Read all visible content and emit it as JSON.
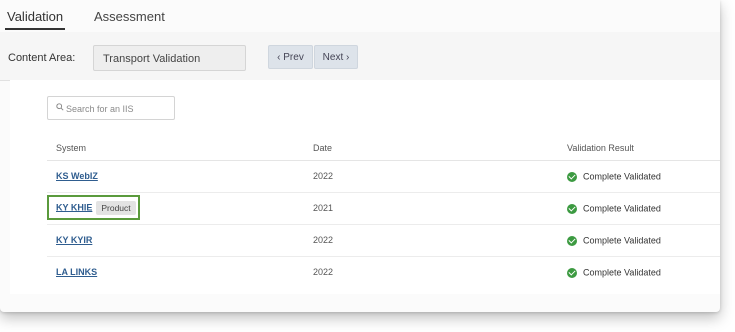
{
  "tabs": [
    {
      "label": "Validation",
      "active": true
    },
    {
      "label": "Assessment",
      "active": false
    }
  ],
  "content_area": {
    "label": "Content Area:",
    "value": "Transport Validation",
    "prev_label": "‹ Prev",
    "next_label": "Next ›"
  },
  "search": {
    "placeholder": "Search for an IIS",
    "icon": "search-icon"
  },
  "table": {
    "headers": [
      "System",
      "Date",
      "Validation Result"
    ],
    "rows": [
      {
        "system": "KS WebIZ",
        "badge": "",
        "date": "2022",
        "result": "Complete Validated"
      },
      {
        "system": "KY KHIE",
        "badge": "Product",
        "date": "2021",
        "result": "Complete Validated"
      },
      {
        "system": "KY KYIR",
        "badge": "",
        "date": "2022",
        "result": "Complete Validated"
      },
      {
        "system": "LA LINKS",
        "badge": "",
        "date": "2022",
        "result": "Complete Validated"
      }
    ]
  },
  "colors": {
    "link": "#2f5d8f",
    "success": "#3c9a41",
    "highlight": "#5a9a3c"
  }
}
